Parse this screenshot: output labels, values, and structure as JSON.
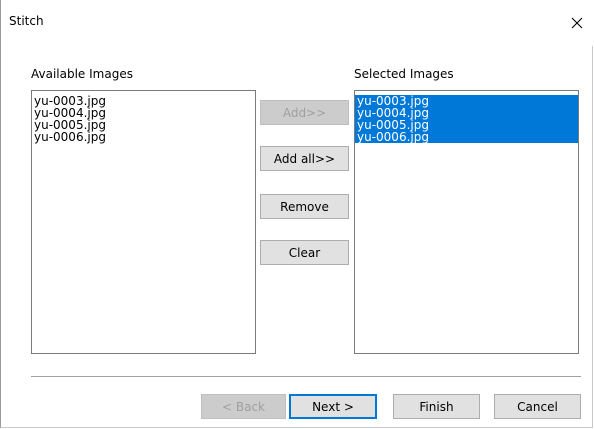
{
  "window": {
    "title": "Stitch"
  },
  "available": {
    "label": "Available Images",
    "items": [
      "yu-0003.jpg",
      "yu-0004.jpg",
      "yu-0005.jpg",
      "yu-0006.jpg"
    ]
  },
  "selected": {
    "label": "Selected Images",
    "items": [
      "yu-0003.jpg",
      "yu-0004.jpg",
      "yu-0005.jpg",
      "yu-0006.jpg"
    ]
  },
  "middle_buttons": {
    "add": "Add>>",
    "add_all": "Add all>>",
    "remove": "Remove",
    "clear": "Clear"
  },
  "footer": {
    "back": "< Back",
    "next": "Next >",
    "finish": "Finish",
    "cancel": "Cancel"
  },
  "colors": {
    "selection": "#0078d7"
  },
  "icons": {
    "close": "close-icon"
  }
}
